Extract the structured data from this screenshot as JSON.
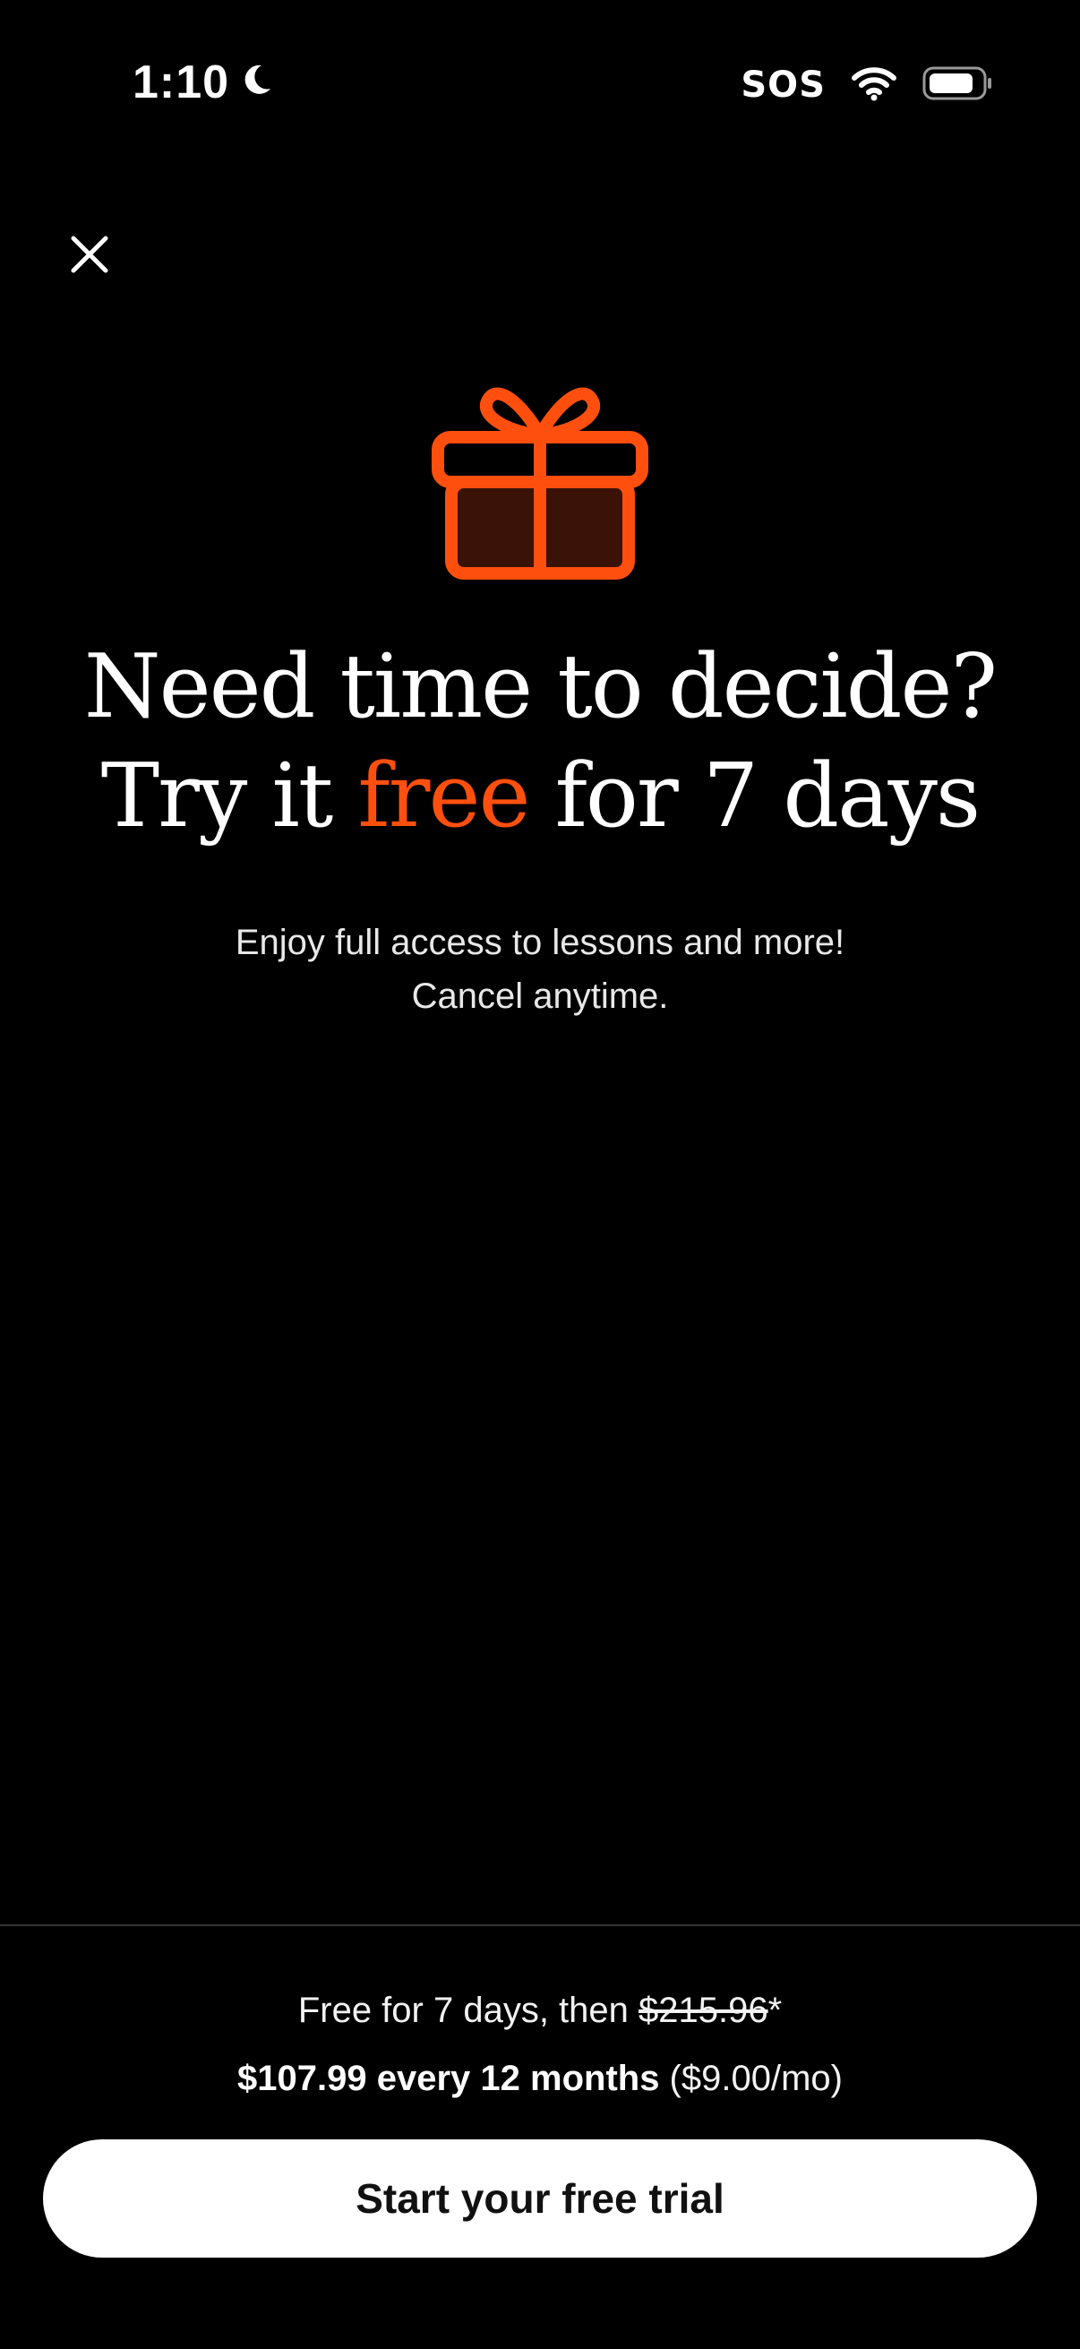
{
  "status_bar": {
    "time": "1:10",
    "carrier": "SOS"
  },
  "colors": {
    "accent": "#ff4f0f",
    "gift_fill": "#3a1208",
    "background": "#000000",
    "cta_background": "#ffffff"
  },
  "icons": {
    "close": "close-icon",
    "gift": "gift-icon",
    "moon": "moon-icon",
    "wifi": "wifi-icon",
    "battery": "battery-icon"
  },
  "headline": {
    "line1": "Need time to decide?",
    "line2_before": "Try it ",
    "line2_accent": "free",
    "line2_after": " for 7 days"
  },
  "subtitle": {
    "line1": "Enjoy full access to lessons and more!",
    "line2": "Cancel anytime."
  },
  "pricing": {
    "trial_prefix": "Free for 7 days, then ",
    "original_price": "$215.96",
    "asterisk": "*",
    "price_plan": "$107.99 every 12 months",
    "monthly": " ($9.00/mo)"
  },
  "cta": {
    "label": "Start your free trial"
  }
}
